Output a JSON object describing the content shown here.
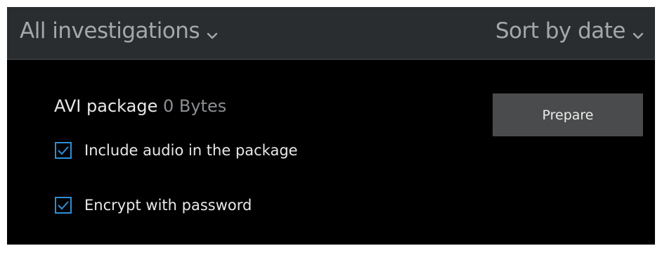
{
  "header": {
    "filter_label": "All investigations",
    "sort_label": "Sort by date"
  },
  "package": {
    "title": "AVI package",
    "size": "0 Bytes",
    "prepare_label": "Prepare"
  },
  "options": [
    {
      "label": "Include audio in the package",
      "checked": true
    },
    {
      "label": "Encrypt with password",
      "checked": true
    }
  ],
  "colors": {
    "header_bg": "#2a2d30",
    "panel_bg": "#000000",
    "checkbox_accent": "#2f8fd6",
    "button_bg": "#4a4b4c",
    "muted_text": "#8c8f92"
  },
  "icons": {
    "dropdown": "chevron-down-icon",
    "checkbox": "checkmark-icon"
  }
}
